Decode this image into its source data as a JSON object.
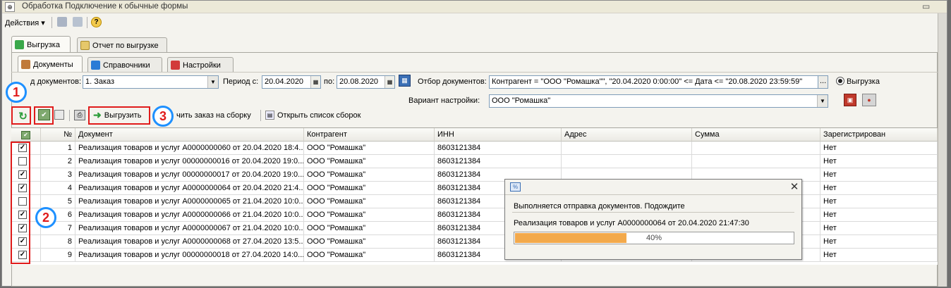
{
  "window": {
    "title": "Обработка  Подключение к обычные формы"
  },
  "menubar": {
    "actions_label": "Действия"
  },
  "tabs_top": [
    {
      "label": "Выгрузка",
      "active": true
    },
    {
      "label": "Отчет по выгрузке",
      "active": false
    }
  ],
  "tabs_sub": [
    {
      "label": "Документы",
      "active": true
    },
    {
      "label": "Справочники",
      "active": false
    },
    {
      "label": "Настройки",
      "active": false
    }
  ],
  "filters": {
    "doc_type_label": "д документов:",
    "doc_type_value": "1. Заказ",
    "period_from_label": "Период с:",
    "period_from_value": "20.04.2020",
    "period_to_label": "по:",
    "period_to_value": "20.08.2020",
    "doc_filter_label": "Отбор документов:",
    "doc_filter_value": "Контрагент = \"ООО \"Ромашка\"\", \"20.04.2020 0:00:00\" <= Дата <= \"20.08.2020 23:59:59\"",
    "ellipsis": "...",
    "radio_label": "Выгрузка",
    "variant_label": "Вариант настройки:",
    "variant_value": "ООО \"Ромашка\""
  },
  "toolbar": {
    "export_label": "Выгрузить",
    "mark_label": "чить заказ на сборку",
    "open_list_label": "Открыть список сборок"
  },
  "table": {
    "headers": [
      "№",
      "Документ",
      "Контрагент",
      "ИНН",
      "Адрес",
      "Сумма",
      "Зарегистрирован"
    ],
    "rows": [
      {
        "checked": true,
        "n": "1",
        "doc": "Реализация товаров и услуг А0000000060 от 20.04.2020 18:4...",
        "kontr": "ООО \"Ромашка\"",
        "inn": "8603121384",
        "addr": "",
        "sum": "",
        "reg": "Нет"
      },
      {
        "checked": false,
        "n": "2",
        "doc": "Реализация товаров и услуг 00000000016 от 20.04.2020 19:0...",
        "kontr": "ООО \"Ромашка\"",
        "inn": "8603121384",
        "addr": "",
        "sum": "",
        "reg": "Нет"
      },
      {
        "checked": true,
        "n": "3",
        "doc": "Реализация товаров и услуг 00000000017 от 20.04.2020 19:0...",
        "kontr": "ООО \"Ромашка\"",
        "inn": "8603121384",
        "addr": "",
        "sum": "",
        "reg": "Нет"
      },
      {
        "checked": true,
        "n": "4",
        "doc": "Реализация товаров и услуг А0000000064 от 20.04.2020 21:4...",
        "kontr": "ООО \"Ромашка\"",
        "inn": "8603121384",
        "addr": "",
        "sum": "",
        "reg": "Нет"
      },
      {
        "checked": false,
        "n": "5",
        "doc": "Реализация товаров и услуг А0000000065 от 21.04.2020 10:0...",
        "kontr": "ООО \"Ромашка\"",
        "inn": "8603121384",
        "addr": "",
        "sum": "",
        "reg": "Нет"
      },
      {
        "checked": true,
        "n": "6",
        "doc": "Реализация товаров и услуг А0000000066 от 21.04.2020 10:0...",
        "kontr": "ООО \"Ромашка\"",
        "inn": "8603121384",
        "addr": "",
        "sum": "",
        "reg": "Нет"
      },
      {
        "checked": true,
        "n": "7",
        "doc": "Реализация товаров и услуг А0000000067 от 21.04.2020 10:0...",
        "kontr": "ООО \"Ромашка\"",
        "inn": "8603121384",
        "addr": "",
        "sum": "",
        "reg": "Нет"
      },
      {
        "checked": true,
        "n": "8",
        "doc": "Реализация товаров и услуг А0000000068 от 27.04.2020 13:5...",
        "kontr": "ООО \"Ромашка\"",
        "inn": "8603121384",
        "addr": "",
        "sum": "",
        "reg": "Нет"
      },
      {
        "checked": true,
        "n": "9",
        "doc": "Реализация товаров и услуг 00000000018 от 27.04.2020 14:0...",
        "kontr": "ООО \"Ромашка\"",
        "inn": "8603121384",
        "addr": "",
        "sum": "",
        "reg": "Нет"
      }
    ]
  },
  "annotations": {
    "one": "1",
    "two": "2",
    "three": "3"
  },
  "progress_dialog": {
    "message": "Выполняется отправка документов. Подождите",
    "current_doc": "Реализация товаров и услуг А0000000064 от 20.04.2020 21:47:30",
    "percent_text": "40%",
    "progress": 0.4
  },
  "colors": {
    "annotation_red": "#e01b1b",
    "annotation_blue": "#1e90ff",
    "progress_fill": "#f3a94b",
    "accent_green": "#2e9e3c"
  }
}
